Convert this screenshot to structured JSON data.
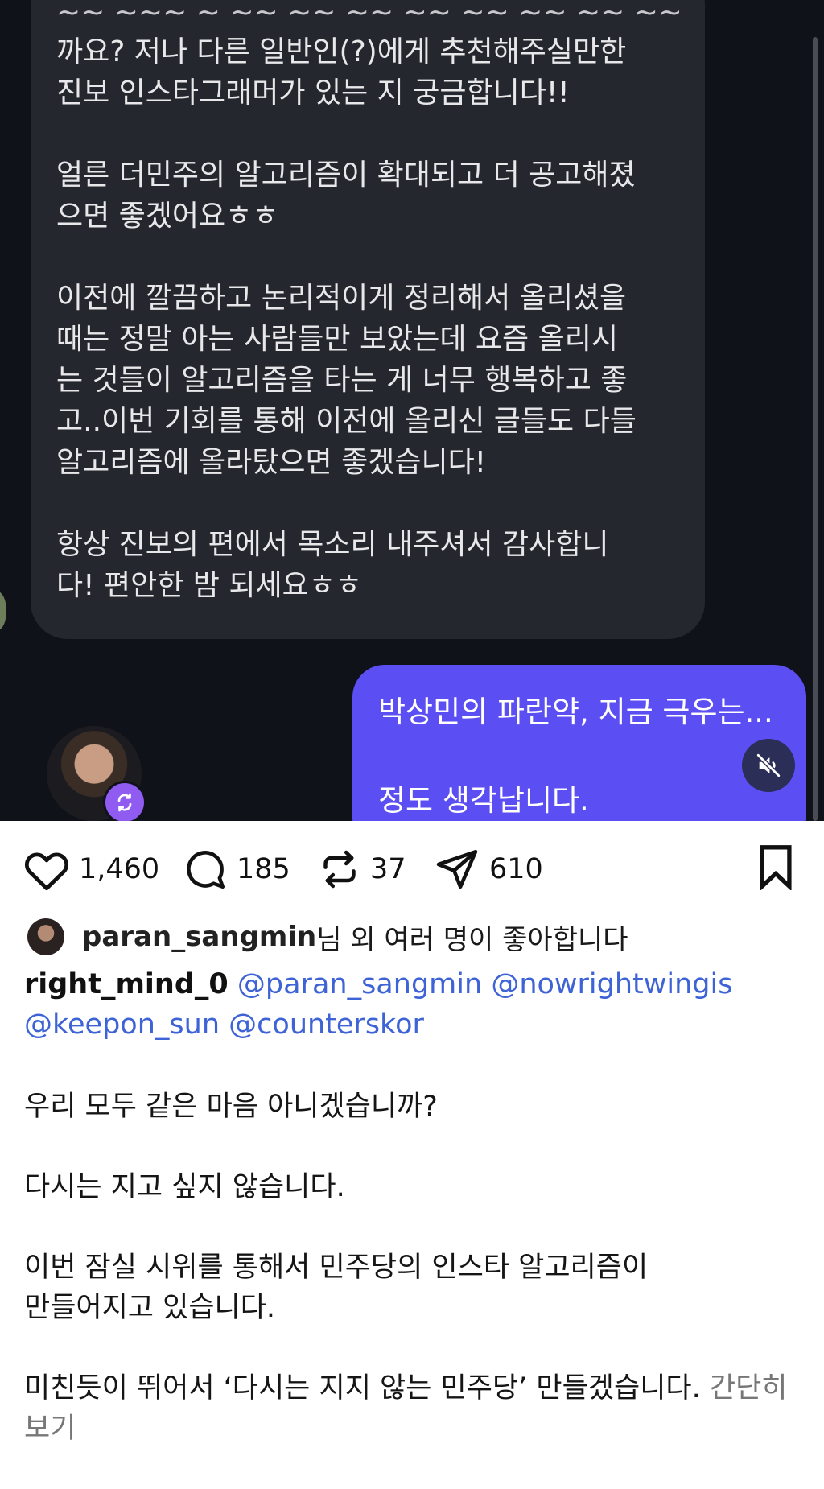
{
  "chat": {
    "incoming_message": {
      "top_partial_line": "~~ ~~~ ~ ~~ ~~ ~~ ~~ ~~ ~~ ~~ ~~~ ~~",
      "paragraphs": [
        [
          "까요? 저나 다른 일반인(?)에게 추천해주실만한",
          "진보 인스타그래머가 있는 지 궁금합니다!!"
        ],
        [
          "얼른 더민주의 알고리즘이 확대되고 더 공고해졌",
          "으면 좋겠어요ㅎㅎ"
        ],
        [
          "이전에 깔끔하고 논리적이게 정리해서 올리셨을",
          "때는 정말 아는 사람들만 보았는데 요즘 올리시",
          "는 것들이 알고리즘을 타는 게 너무 행복하고 좋",
          "고..이번 기회를 통해 이전에 올리신 글들도 다들",
          "알고리즘에 올라탔으면 좋겠습니다!"
        ],
        [
          "항상 진보의 편에서 목소리 내주셔서 감사합니",
          "다! 편안한 밤 되세요ㅎㅎ"
        ]
      ]
    },
    "outgoing_message": {
      "line1": "박상민의 파란약, 지금 극우는...",
      "line2": "정도 생각납니다."
    },
    "icons": {
      "mute": "speaker-muted-icon",
      "repost_badge": "repost-icon"
    }
  },
  "post": {
    "actions": {
      "likes": "1,460",
      "comments": "185",
      "reposts": "37",
      "shares": "610"
    },
    "liked_by": {
      "username": "paran_sangmin",
      "suffix": "님 외 여러 명이 좋아합니다"
    },
    "caption": {
      "author": "right_mind_0",
      "mentions": [
        "@paran_sangmin",
        "@nowrightwingis",
        "@keepon_sun",
        "@counterskor"
      ]
    },
    "body": [
      [
        "우리 모두 같은 마음 아니겠습니까?"
      ],
      [
        "다시는 지고 싶지 않습니다."
      ],
      [
        "이번 잠실 시위를 통해서 민주당의 인스타 알고리즘이",
        "만들어지고 있습니다."
      ],
      [
        "미친듯이 뛰어서 ‘다시는 지지 않는 민주당’ 만들겠습니다."
      ]
    ],
    "more_label_line1": "간단히",
    "more_label_line2": "보기"
  },
  "colors": {
    "chat_bg": "#10121a",
    "incoming_bubble": "#25272f",
    "outgoing_bubble": "#5b4ef2",
    "mention": "#3d63d6",
    "repost_badge": "#8f5bf0"
  }
}
